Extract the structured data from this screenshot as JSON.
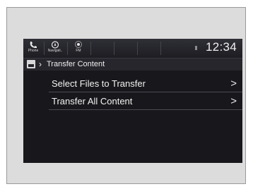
{
  "statusbar": {
    "icons": [
      {
        "name": "phone-icon",
        "label": "Phone"
      },
      {
        "name": "navigation-icon",
        "label": "Navigati.."
      },
      {
        "name": "fm-radio-icon",
        "label": "FM"
      }
    ],
    "clock": "12:34"
  },
  "breadcrumb": {
    "home_icon": "home-icon",
    "title": "Transfer Content"
  },
  "menu": {
    "items": [
      {
        "label": "Select Files to Transfer"
      },
      {
        "label": "Transfer All Content"
      }
    ]
  },
  "colors": {
    "screen_bg": "#18181c",
    "frame_bg": "#dcdcdc",
    "text": "#f2f2f2"
  }
}
